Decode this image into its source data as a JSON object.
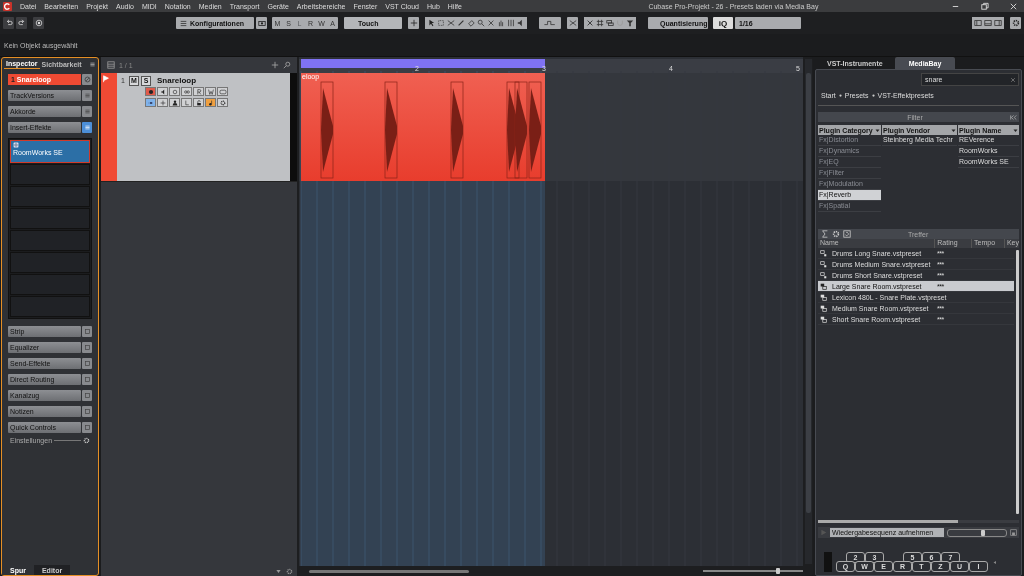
{
  "title_bar": {
    "menu": [
      "Datei",
      "Bearbeiten",
      "Projekt",
      "Audio",
      "MIDI",
      "Notation",
      "Medien",
      "Transport",
      "Geräte",
      "Arbeitsbereiche",
      "Fenster",
      "VST Cloud",
      "Hub",
      "Hilfe"
    ],
    "title": "Cubase Pro-Projekt - 26 - Presets laden via Media Bay"
  },
  "toolbar": {
    "configurations": "Konfigurationen",
    "track_buttons": [
      {
        "label": "M",
        "disabled": false
      },
      {
        "label": "S",
        "disabled": false
      },
      {
        "label": "L",
        "disabled": true
      },
      {
        "label": "R",
        "disabled": false
      },
      {
        "label": "W",
        "disabled": false
      },
      {
        "label": "A",
        "disabled": false
      }
    ],
    "automation_mode": "Touch",
    "quantize": "Quantisierung",
    "iq": "iQ",
    "quantize_value": "1/16"
  },
  "info_line": "Kein Objekt ausgewählt",
  "inspector": {
    "tabs": [
      {
        "label": "Inspector",
        "selected": true
      },
      {
        "label": "Sichtbarkeit",
        "selected": false
      }
    ],
    "track": {
      "number": "1",
      "name": "Snareloop"
    },
    "sections": [
      {
        "label": "TrackVersions",
        "active": false
      },
      {
        "label": "Akkorde",
        "active": false
      },
      {
        "label": "Insert-Effekte",
        "active": true
      }
    ],
    "insert_slots": [
      {
        "name": "RoomWorks SE",
        "selected": true
      }
    ],
    "lower_sections": [
      "Strip",
      "Equalizer",
      "Send-Effekte",
      "Direct Routing",
      "Kanalzug",
      "Notizen",
      "Quick Controls"
    ],
    "settings": "Einstellungen",
    "bottom_tabs": [
      {
        "label": "Spur",
        "selected": true
      },
      {
        "label": "Editor",
        "selected": false
      }
    ]
  },
  "track_list": {
    "counter": "1 / 1",
    "tracks": [
      {
        "number": "1",
        "buttons": [
          "M",
          "S"
        ],
        "name": "Snareloop",
        "color": "#f04a34"
      }
    ]
  },
  "arranger": {
    "ruler": [
      "2",
      "3",
      "4",
      "5"
    ],
    "events": [
      {
        "name": "eloop"
      }
    ],
    "zoom": {
      "level": 0.75
    }
  },
  "media_bay": {
    "tabs": [
      {
        "label": "VST-Instrumente",
        "selected": false
      },
      {
        "label": "MediaBay",
        "selected": true
      }
    ],
    "search": "snare",
    "breadcrumb": [
      "Start",
      "Presets",
      "VST-Effektpresets"
    ],
    "filter_title": "Filter",
    "filter_columns": [
      {
        "title": "Plugin Category",
        "items": [
          {
            "label": "Fx|Distortion",
            "selected": false,
            "disabled": true
          },
          {
            "label": "Fx|Dynamics",
            "selected": false,
            "disabled": true
          },
          {
            "label": "Fx|EQ",
            "selected": false,
            "disabled": true
          },
          {
            "label": "Fx|Filter",
            "selected": false,
            "disabled": true
          },
          {
            "label": "Fx|Modulation",
            "selected": false,
            "disabled": true
          },
          {
            "label": "Fx|Reverb",
            "selected": true,
            "disabled": false
          },
          {
            "label": "Fx|Spatial",
            "selected": false,
            "disabled": true
          }
        ]
      },
      {
        "title": "Plugin Vendor",
        "items": [
          {
            "label": "Steinberg Media Techr",
            "selected": false,
            "disabled": false
          }
        ]
      },
      {
        "title": "Plugin Name",
        "items": [
          {
            "label": "REVerence",
            "selected": false,
            "disabled": false
          },
          {
            "label": "RoomWorks",
            "selected": false,
            "disabled": false
          },
          {
            "label": "RoomWorks SE",
            "selected": false,
            "disabled": false
          }
        ]
      }
    ],
    "results": {
      "title": "Treffer",
      "columns": [
        "Name",
        "Rating",
        "Tempo",
        "Key"
      ],
      "rows": [
        {
          "kind": "single",
          "name": "Drums Long Snare.vstpreset",
          "rating": "***",
          "selected": false
        },
        {
          "kind": "single",
          "name": "Drums Medium Snare.vstpreset",
          "rating": "***",
          "selected": false
        },
        {
          "kind": "single",
          "name": "Drums Short Snare.vstpreset",
          "rating": "***",
          "selected": false
        },
        {
          "kind": "rack",
          "name": "Large Snare Room.vstpreset",
          "rating": "***",
          "selected": true
        },
        {
          "kind": "rack",
          "name": "Lexicon 480L - Snare Plate.vstpreset",
          "selected": false
        },
        {
          "kind": "rack",
          "name": "Medium Snare Room.vstpreset",
          "rating": "***",
          "selected": false
        },
        {
          "kind": "rack",
          "name": "Short Snare Room.vstpreset",
          "rating": "***",
          "selected": false
        }
      ]
    },
    "playback": "Wiedergabesequenz aufnehmen",
    "volume": {
      "level": 0.6
    },
    "keyboard": {
      "upper": [
        "2",
        "3",
        "5",
        "6",
        "7"
      ],
      "lower": [
        "Q",
        "W",
        "E",
        "R",
        "T",
        "Z",
        "U",
        "I"
      ]
    }
  }
}
